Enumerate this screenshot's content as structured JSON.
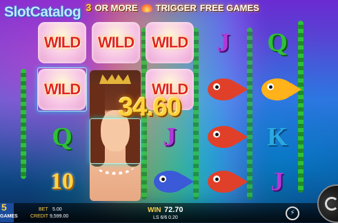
{
  "watermark": "SlotCatalog",
  "banner": {
    "prefix": "3",
    "text1": "OR MORE",
    "text2": "TRIGGER",
    "text3": "FREE GAMES"
  },
  "reels": [
    {
      "cells": [
        {
          "type": "wild",
          "label": "WILD"
        },
        {
          "type": "wild",
          "label": "WILD"
        },
        {
          "type": "letter",
          "label": "Q",
          "color": "#2fbf3a"
        },
        {
          "type": "number",
          "label": "10"
        }
      ]
    },
    {
      "cells": [
        {
          "type": "wild",
          "label": "WILD"
        },
        {
          "type": "mermaid"
        }
      ]
    },
    {
      "cells": [
        {
          "type": "wild",
          "label": "WILD"
        },
        {
          "type": "wild",
          "label": "WILD"
        },
        {
          "type": "letter",
          "label": "J",
          "color": "#b03ad8"
        },
        {
          "type": "fish",
          "color": "#3a3ad8"
        }
      ]
    },
    {
      "cells": [
        {
          "type": "letter",
          "label": "J",
          "color": "#b03ad8"
        },
        {
          "type": "fish",
          "color": "#e0402a"
        },
        {
          "type": "fish",
          "color": "#e0402a"
        },
        {
          "type": "fish",
          "color": "#e0402a"
        }
      ]
    },
    {
      "cells": [
        {
          "type": "letter",
          "label": "Q",
          "color": "#2fbf3a"
        },
        {
          "type": "fish",
          "color": "#ffb21a"
        },
        {
          "type": "letter",
          "label": "K",
          "color": "#2aa8e0"
        },
        {
          "type": "letter",
          "label": "J",
          "color": "#b03ad8"
        }
      ]
    }
  ],
  "win_float": "34.60",
  "bottom": {
    "free_games_count": "5",
    "free_games_label": "GAMES",
    "bet_label": "BET",
    "bet_value": "5.00",
    "credit_label": "CREDIT",
    "credit_value": "9,599.00",
    "win_label": "WIN",
    "win_value": "72.70",
    "ls_text": "LS 6/6 0.20"
  }
}
